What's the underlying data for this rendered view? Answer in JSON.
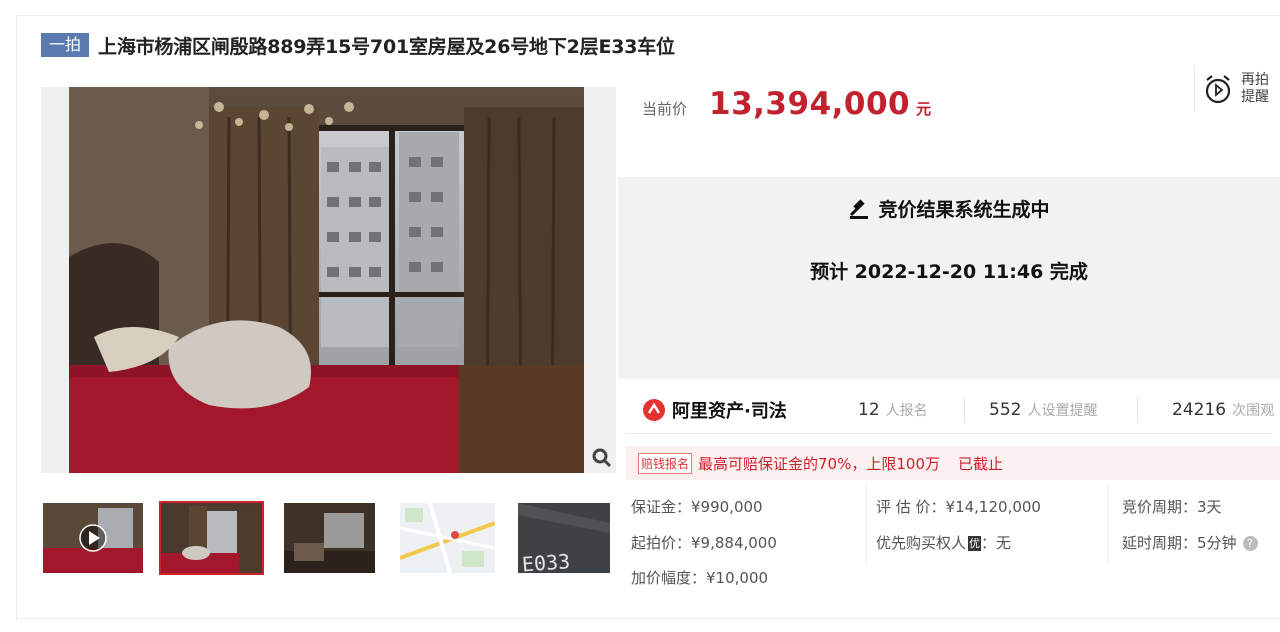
{
  "title": {
    "badge": "一拍",
    "text": "上海市杨浦区闸殷路889弄15号701室房屋及26号地下2层E33车位"
  },
  "price": {
    "label": "当前价",
    "value": "13,394,000",
    "unit": "元"
  },
  "remind": {
    "line1": "再拍",
    "line2": "提醒"
  },
  "status": {
    "title": "竞价结果系统生成中",
    "subtitle": "预计 2022-12-20 11:46 完成"
  },
  "brand": {
    "name": "阿里资产·司法"
  },
  "stats": [
    {
      "value": "12",
      "label": "人报名"
    },
    {
      "value": "552",
      "label": "人设置提醒"
    },
    {
      "value": "24216",
      "label": "次围观"
    }
  ],
  "notice": {
    "tag": "赔钱报名",
    "text": "最高可赔保证金的70%，上限100万",
    "status": "已截止"
  },
  "info": {
    "deposit": "保证金：¥990,000",
    "start_price": "起拍价：¥9,884,000",
    "increment": "加价幅度：¥10,000",
    "appraisal": "评 估 价：¥14,120,000",
    "priority_label": "优先购买权人",
    "priority_badge": "优",
    "priority_value": "：无",
    "cycle": "竞价周期：3天",
    "delay": "延时周期：5分钟"
  },
  "thumbnails": [
    {
      "name": "video-thumbnail",
      "selected": false
    },
    {
      "name": "bedroom-thumbnail",
      "selected": true
    },
    {
      "name": "living-room-thumbnail",
      "selected": false
    },
    {
      "name": "map-thumbnail",
      "selected": false
    },
    {
      "name": "parking-thumbnail",
      "selected": false,
      "text": "E033"
    }
  ],
  "colors": {
    "accent": "#c2212e",
    "badge": "#5a7bb0"
  }
}
